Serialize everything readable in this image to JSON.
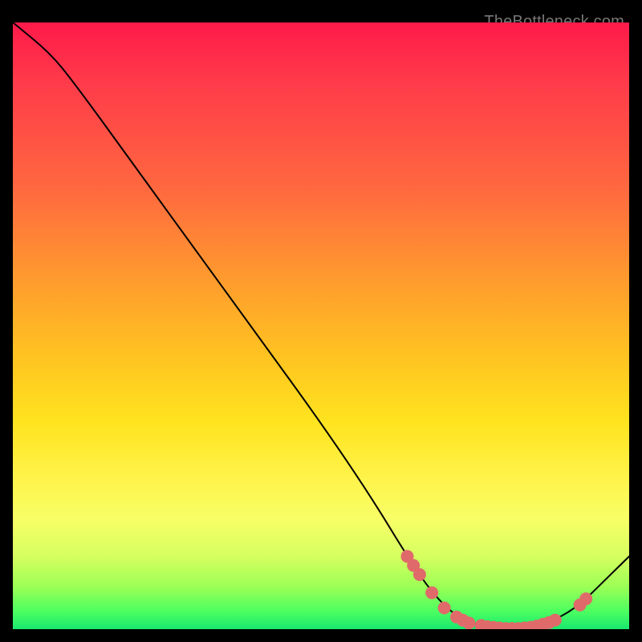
{
  "attribution": "TheBottleneck.com",
  "colors": {
    "curve_stroke": "#000000",
    "marker_fill": "#e06a6a",
    "marker_stroke": "#c65a5a"
  },
  "chart_data": {
    "type": "line",
    "title": "",
    "xlabel": "",
    "ylabel": "",
    "xlim": [
      0,
      100
    ],
    "ylim": [
      0,
      100
    ],
    "curve": [
      {
        "x": 0,
        "y": 100
      },
      {
        "x": 6,
        "y": 95
      },
      {
        "x": 10,
        "y": 90
      },
      {
        "x": 20,
        "y": 76
      },
      {
        "x": 30,
        "y": 62
      },
      {
        "x": 40,
        "y": 48
      },
      {
        "x": 50,
        "y": 34
      },
      {
        "x": 58,
        "y": 22
      },
      {
        "x": 64,
        "y": 12
      },
      {
        "x": 68,
        "y": 6
      },
      {
        "x": 72,
        "y": 2
      },
      {
        "x": 76,
        "y": 0.5
      },
      {
        "x": 80,
        "y": 0
      },
      {
        "x": 84,
        "y": 0.3
      },
      {
        "x": 88,
        "y": 1.5
      },
      {
        "x": 92,
        "y": 4
      },
      {
        "x": 96,
        "y": 8
      },
      {
        "x": 100,
        "y": 12
      }
    ],
    "markers": [
      {
        "x": 64,
        "y": 12
      },
      {
        "x": 65,
        "y": 10.5
      },
      {
        "x": 66,
        "y": 9
      },
      {
        "x": 68,
        "y": 6
      },
      {
        "x": 70,
        "y": 3.5
      },
      {
        "x": 72,
        "y": 2
      },
      {
        "x": 73,
        "y": 1.5
      },
      {
        "x": 74,
        "y": 1
      },
      {
        "x": 76,
        "y": 0.6
      },
      {
        "x": 77,
        "y": 0.4
      },
      {
        "x": 78,
        "y": 0.3
      },
      {
        "x": 79,
        "y": 0.2
      },
      {
        "x": 80,
        "y": 0.1
      },
      {
        "x": 81,
        "y": 0.1
      },
      {
        "x": 82,
        "y": 0.1
      },
      {
        "x": 83,
        "y": 0.2
      },
      {
        "x": 84,
        "y": 0.3
      },
      {
        "x": 85,
        "y": 0.5
      },
      {
        "x": 86,
        "y": 0.8
      },
      {
        "x": 87,
        "y": 1.1
      },
      {
        "x": 88,
        "y": 1.5
      },
      {
        "x": 92,
        "y": 4
      },
      {
        "x": 93,
        "y": 5
      }
    ]
  }
}
